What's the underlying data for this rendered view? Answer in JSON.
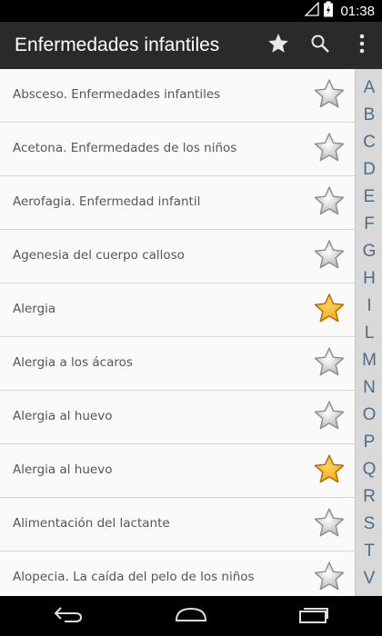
{
  "status_bar": {
    "time": "01:38",
    "icons": [
      "signal-icon",
      "battery-icon"
    ]
  },
  "action_bar": {
    "title": "Enfermedades infantiles",
    "actions": [
      "favorites-star-icon",
      "search-icon",
      "overflow-menu-icon"
    ]
  },
  "list": {
    "items": [
      {
        "label": "Absceso. Enfermedades infantiles",
        "favorite": false
      },
      {
        "label": "Acetona. Enfermedades de los niños",
        "favorite": false
      },
      {
        "label": "Aerofagia. Enfermedad infantil",
        "favorite": false
      },
      {
        "label": "Agenesia del cuerpo calloso",
        "favorite": false
      },
      {
        "label": "Alergia",
        "favorite": true
      },
      {
        "label": "Alergia a los ácaros",
        "favorite": false
      },
      {
        "label": "Alergia al huevo",
        "favorite": false
      },
      {
        "label": "Alergia al huevo",
        "favorite": true
      },
      {
        "label": "Alimentación del lactante",
        "favorite": false
      },
      {
        "label": "Alopecia. La caída del pelo de los niños",
        "favorite": false
      }
    ]
  },
  "index_bar": {
    "letters": [
      "A",
      "B",
      "C",
      "D",
      "E",
      "F",
      "G",
      "H",
      "I",
      "L",
      "M",
      "N",
      "O",
      "P",
      "Q",
      "R",
      "S",
      "T",
      "V"
    ]
  },
  "nav_bar": {
    "buttons": [
      "back-icon",
      "home-icon",
      "recents-icon"
    ]
  },
  "colors": {
    "action_bar": "#2a2a2a",
    "index_letter": "#4a6e8a",
    "favorite_star": "#f5a623",
    "inactive_star": "#b8b8b8"
  }
}
